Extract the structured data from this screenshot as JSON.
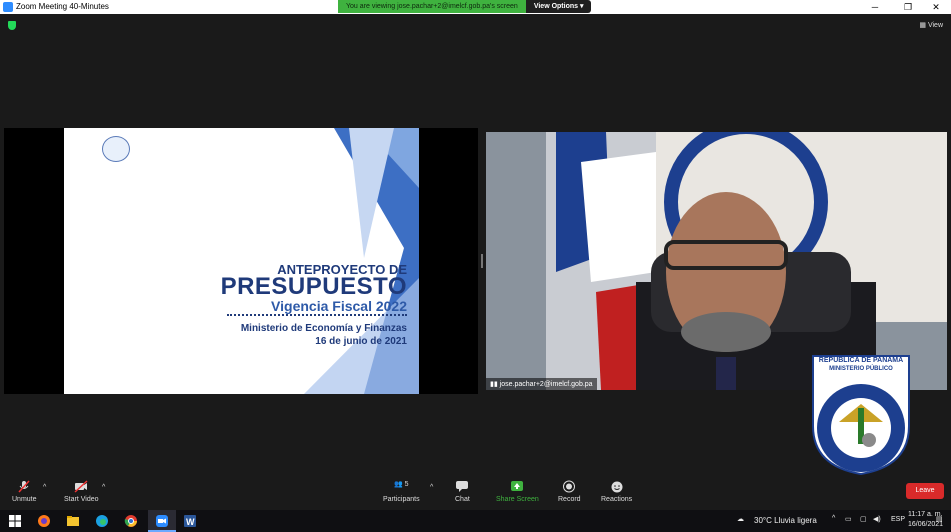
{
  "window": {
    "title": "Zoom Meeting 40-Minutes"
  },
  "share_banner": {
    "message": "You are viewing jose.pachar+2@imelcf.gob.pa's screen",
    "options_label": "View Options ▾"
  },
  "view_button": {
    "label": "View"
  },
  "slide": {
    "line1": "ANTEPROYECTO DE",
    "line2": "PRESUPUESTO",
    "line3": "Vigencia Fiscal 2022",
    "line4": "Ministerio de Economía y Finanzas",
    "line5": "16 de junio de 2021"
  },
  "participant_video": {
    "name": "jose.pachar+2@imelcf.gob.pa"
  },
  "seal": {
    "top1": "REPÚBLICA DE PANAMÁ",
    "top2": "MINISTERIO PÚBLICO",
    "ring": "INSTITUTO DE MEDICINA LEGAL Y CIENCIAS FORENSES"
  },
  "toolbar": {
    "unmute": "Unmute",
    "start_video": "Start Video",
    "participants": "Participants",
    "participants_count": "5",
    "chat": "Chat",
    "share_screen": "Share Screen",
    "record": "Record",
    "reactions": "Reactions",
    "leave": "Leave"
  },
  "taskbar": {
    "weather": "30°C  Lluvia ligera",
    "language": "ESP",
    "time": "11:17 a. m.",
    "date": "16/06/2021"
  },
  "colors": {
    "share_green": "#3fb23f",
    "leave_red": "#d92a2a",
    "slide_blue": "#1f3a7a",
    "zoom_blue": "#2d8cff"
  }
}
